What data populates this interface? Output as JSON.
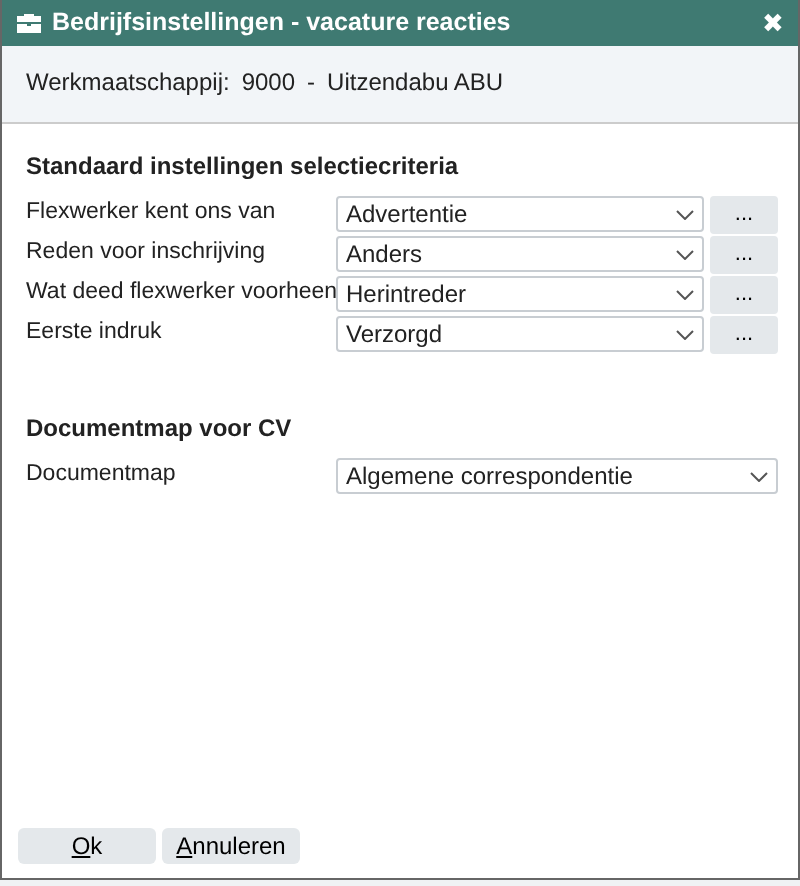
{
  "window": {
    "title": "Bedrijfsinstellingen - vacature reacties",
    "close": "✖"
  },
  "company": {
    "label": "Werkmaatschappij:",
    "code": "9000",
    "separator": "-",
    "name": "Uitzendabu ABU"
  },
  "sections": [
    {
      "heading": "Standaard instellingen selectiecriteria",
      "fields": [
        {
          "label": "Flexwerker kent ons van",
          "value": "Advertentie",
          "button": "..."
        },
        {
          "label": "Reden voor inschrijving",
          "value": "Anders",
          "button": "..."
        },
        {
          "label": "Wat deed flexwerker voorheen",
          "value": "Herintreder",
          "button": "..."
        },
        {
          "label": "Eerste indruk",
          "value": "Verzorgd",
          "button": "..."
        }
      ]
    },
    {
      "heading": "Documentmap voor CV",
      "fields": [
        {
          "label": "Documentmap",
          "value": "Algemene correspondentie"
        }
      ]
    }
  ],
  "buttons": [
    {
      "accel": "O",
      "rest": "k"
    },
    {
      "accel": "A",
      "rest": "nnuleren"
    }
  ]
}
